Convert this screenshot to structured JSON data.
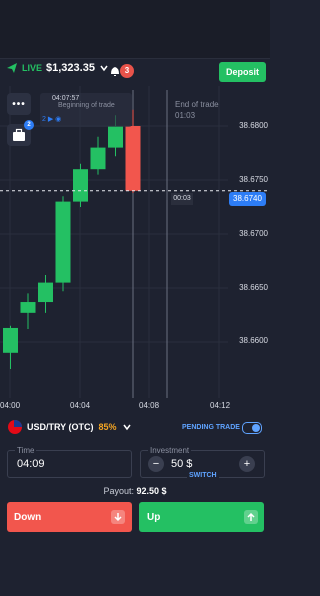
{
  "header": {
    "live_label": "LIVE",
    "balance": "$1,323.35",
    "notification_count": "3",
    "deposit_label": "Deposit"
  },
  "trade_info": {
    "time": "04:07:57",
    "description": "Beginning of trade",
    "count": "2"
  },
  "chart": {
    "end_of_trade_label": "End of trade",
    "end_of_trade_time": "01:03",
    "timer": "00:03",
    "current_price": "38.6740",
    "price_levels": [
      "38.6800",
      "38.6750",
      "38.6700",
      "38.6650",
      "38.6600"
    ],
    "time_labels": [
      "04:00",
      "04:04",
      "04:08",
      "04:12"
    ]
  },
  "chart_data": {
    "type": "candlestick",
    "ylim": [
      38.6565,
      38.6825
    ],
    "candles": [
      {
        "open": 38.659,
        "high": 38.6615,
        "low": 38.6575,
        "close": 38.6613
      },
      {
        "open": 38.6627,
        "high": 38.6645,
        "low": 38.6612,
        "close": 38.6637
      },
      {
        "open": 38.6637,
        "high": 38.6662,
        "low": 38.6627,
        "close": 38.6655
      },
      {
        "open": 38.6655,
        "high": 38.6735,
        "low": 38.6647,
        "close": 38.673
      },
      {
        "open": 38.673,
        "high": 38.6765,
        "low": 38.6725,
        "close": 38.676
      },
      {
        "open": 38.676,
        "high": 38.679,
        "low": 38.6755,
        "close": 38.678
      },
      {
        "open": 38.678,
        "high": 38.681,
        "low": 38.6772,
        "close": 38.68
      },
      {
        "open": 38.68,
        "high": 38.6815,
        "low": 38.6738,
        "close": 38.674
      }
    ],
    "current_price": 38.674
  },
  "asset": {
    "pair": "USD/TRY (OTC)",
    "payout_pct": "85%",
    "pending_trade_label": "PENDING TRADE"
  },
  "order": {
    "time_label": "Time",
    "time_value": "04:09",
    "investment_label": "Investment",
    "investment_value": "50 $",
    "switch_label": "SWITCH",
    "payout_label": "Payout:",
    "payout_value": "92.50 $",
    "down_label": "Down",
    "up_label": "Up"
  },
  "colors": {
    "up": "#24c063",
    "down": "#f2564d",
    "accent": "#2d7df6",
    "background": "#1e2230"
  }
}
